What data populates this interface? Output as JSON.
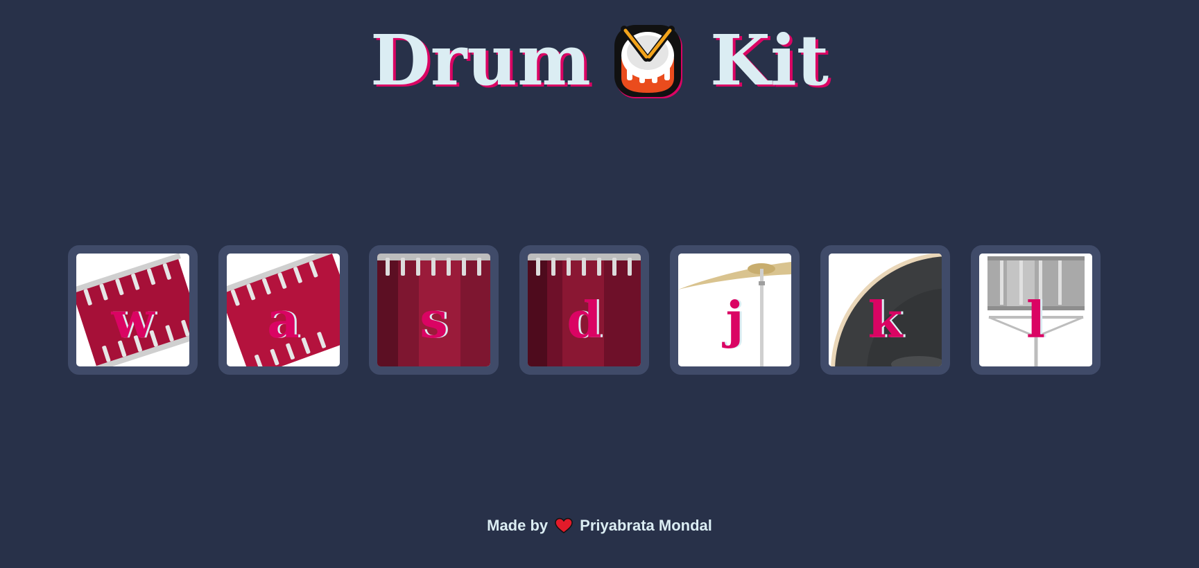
{
  "page": {
    "title_left": "Drum",
    "title_right": "Kit",
    "title_icon": "drum-icon"
  },
  "drums": [
    {
      "key": "w",
      "art": "tom-1-icon"
    },
    {
      "key": "a",
      "art": "tom-2-icon"
    },
    {
      "key": "s",
      "art": "tom-3-icon"
    },
    {
      "key": "d",
      "art": "tom-4-icon"
    },
    {
      "key": "j",
      "art": "crash-icon"
    },
    {
      "key": "k",
      "art": "kick-icon"
    },
    {
      "key": "l",
      "art": "snare-icon"
    }
  ],
  "footer": {
    "made_by": "Made by",
    "heart_icon": "heart-icon",
    "author": "Priyabrata Mondal"
  },
  "colors": {
    "background": "#283149",
    "button_frame": "#404b69",
    "accent": "#da0463",
    "text": "#dbedf3"
  }
}
